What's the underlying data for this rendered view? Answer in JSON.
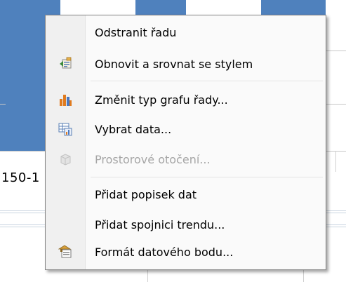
{
  "chart": {
    "axis_label": "150-1",
    "bar_color": "#4f81bd"
  },
  "menu": {
    "items": [
      {
        "label": "Odstranit řadu",
        "icon": "",
        "enabled": true
      },
      {
        "label": "Obnovit a srovnat se stylem",
        "icon": "reset-style-icon",
        "enabled": true
      },
      {
        "label": "Změnit typ grafu řady...",
        "icon": "chart-type-icon",
        "enabled": true
      },
      {
        "label": "Vybrat data...",
        "icon": "select-data-icon",
        "enabled": true
      },
      {
        "label": "Prostorové otočení...",
        "icon": "3d-rotation-icon",
        "enabled": false
      },
      {
        "label": "Přidat popisek dat",
        "icon": "",
        "enabled": true
      },
      {
        "label": "Přidat spojnici trendu...",
        "icon": "",
        "enabled": true
      },
      {
        "label": "Formát datového bodu...",
        "icon": "format-data-point-icon",
        "enabled": true
      }
    ]
  }
}
